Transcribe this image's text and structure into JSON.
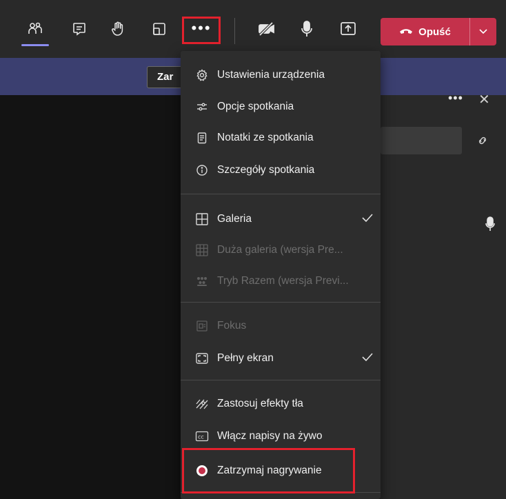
{
  "toolbar": {
    "icons": [
      "people-icon",
      "chat-icon",
      "raise-hand-icon",
      "breakout-rooms-icon",
      "more-options-icon",
      "camera-off-icon",
      "microphone-icon",
      "share-screen-icon"
    ],
    "more_label": "•••",
    "leave_label": "Opuść",
    "accent_color": "#c4314b"
  },
  "background": {
    "banner_button_label": "Zar"
  },
  "menu": {
    "sections": [
      {
        "items": [
          {
            "label": "Ustawienia urządzenia",
            "icon": "gear-icon",
            "enabled": true
          },
          {
            "label": "Opcje spotkania",
            "icon": "sliders-icon",
            "enabled": true
          },
          {
            "label": "Notatki ze spotkania",
            "icon": "notes-icon",
            "enabled": true
          },
          {
            "label": "Szczegóły spotkania",
            "icon": "info-icon",
            "enabled": true
          }
        ]
      },
      {
        "items": [
          {
            "label": "Galeria",
            "icon": "gallery-icon",
            "enabled": true,
            "checked": true
          },
          {
            "label": "Duża galeria (wersja Pre...",
            "icon": "large-gallery-icon",
            "enabled": false
          },
          {
            "label": "Tryb Razem (wersja Previ...",
            "icon": "together-mode-icon",
            "enabled": false
          }
        ]
      },
      {
        "items": [
          {
            "label": "Fokus",
            "icon": "focus-icon",
            "enabled": false
          },
          {
            "label": "Pełny ekran",
            "icon": "fullscreen-icon",
            "enabled": true,
            "checked": true
          }
        ]
      },
      {
        "items": [
          {
            "label": "Zastosuj efekty tła",
            "icon": "background-effects-icon",
            "enabled": true
          },
          {
            "label": "Włącz napisy na żywo",
            "icon": "captions-icon",
            "enabled": true
          },
          {
            "label": "Zatrzymaj nagrywanie",
            "icon": "record-icon",
            "enabled": true
          }
        ]
      }
    ]
  },
  "highlight_color": "#e3212d"
}
